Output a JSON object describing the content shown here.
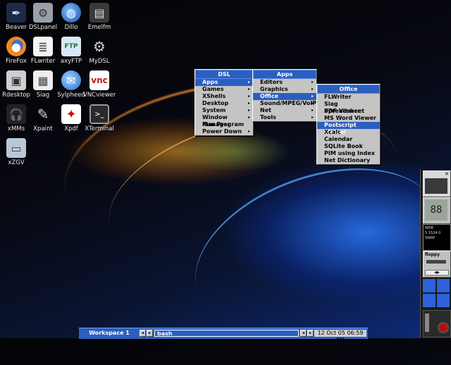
{
  "desktop": {
    "icons": [
      {
        "label": "Beaver",
        "icon": "feather-pen-icon"
      },
      {
        "label": "DSLpanel",
        "icon": "control-panel-icon"
      },
      {
        "label": "Dillo",
        "icon": "globe-icon"
      },
      {
        "label": "Emelfm",
        "icon": "file-cabinet-icon"
      },
      {
        "label": "FireFox",
        "icon": "firefox-icon"
      },
      {
        "label": "FLwriter",
        "icon": "document-icon"
      },
      {
        "label": "axyFTP",
        "icon": "ftp-icon"
      },
      {
        "label": "MyDSL",
        "icon": "gears-icon"
      },
      {
        "label": "Rdesktop",
        "icon": "network-computers-icon"
      },
      {
        "label": "Siag",
        "icon": "spreadsheet-icon"
      },
      {
        "label": "Sylpheed",
        "icon": "mail-globe-icon"
      },
      {
        "label": "VNCviewer",
        "icon": "vnc-icon"
      },
      {
        "label": "xMMs",
        "icon": "penguin-headphones-icon"
      },
      {
        "label": "Xpaint",
        "icon": "paintbrush-icon"
      },
      {
        "label": "Xpdf",
        "icon": "pdf-icon"
      },
      {
        "label": "XTerminal",
        "icon": "terminal-icon"
      },
      {
        "label": "xZGV",
        "icon": "image-viewer-icon"
      }
    ]
  },
  "menus": {
    "dsl": {
      "title": "DSL",
      "items": [
        "Apps",
        "Games",
        "XShells",
        "Desktop",
        "System",
        "Window Manager",
        "Run Program",
        "Power Down"
      ]
    },
    "apps": {
      "title": "Apps",
      "items": [
        "Editors",
        "Graphics",
        "Office",
        "Sound/MPEG/VoIP",
        "Net",
        "Tools"
      ]
    },
    "office": {
      "title": "Office",
      "items": [
        "FLWriter",
        "Siag Spreadsheet",
        "PDF Viewer",
        "MS Word Viewer",
        "Postscript Viewer",
        "Xcalc",
        "Calendar",
        "SQLite Book",
        "PIM using Index",
        "Net Dictionary"
      ]
    }
  },
  "dock": {
    "mem_label": "MEM",
    "swap_label": "SWAP",
    "mem_values": "5 1524 0",
    "floppy_label": "floppy"
  },
  "taskbar": {
    "workspace": "Workspace 1",
    "task": "bash",
    "clock": "12 Oct 05 06:59 PM"
  },
  "colors": {
    "menu_title": "#2a5fbf",
    "menu_bg": "#c4c4c4",
    "taskbar": "#2a5fbf"
  }
}
